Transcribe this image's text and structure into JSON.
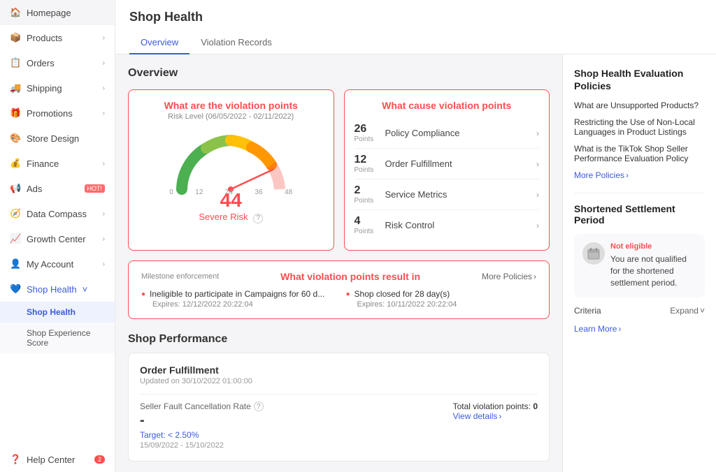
{
  "sidebar": {
    "items": [
      {
        "id": "homepage",
        "label": "Homepage",
        "icon": "🏠",
        "expandable": false
      },
      {
        "id": "products",
        "label": "Products",
        "icon": "📦",
        "expandable": true
      },
      {
        "id": "orders",
        "label": "Orders",
        "icon": "📋",
        "expandable": true
      },
      {
        "id": "shipping",
        "label": "Shipping",
        "icon": "🚚",
        "expandable": true
      },
      {
        "id": "promotions",
        "label": "Promotions",
        "icon": "🎁",
        "expandable": true
      },
      {
        "id": "store-design",
        "label": "Store Design",
        "icon": "🎨",
        "expandable": false
      },
      {
        "id": "finance",
        "label": "Finance",
        "icon": "💰",
        "expandable": true
      },
      {
        "id": "ads",
        "label": "Ads",
        "icon": "📢",
        "expandable": false,
        "badge": "HOT!"
      },
      {
        "id": "data-compass",
        "label": "Data Compass",
        "icon": "🧭",
        "expandable": true
      },
      {
        "id": "growth-center",
        "label": "Growth Center",
        "icon": "📈",
        "expandable": true
      },
      {
        "id": "my-account",
        "label": "My Account",
        "icon": "👤",
        "expandable": true
      },
      {
        "id": "shop-health",
        "label": "Shop Health",
        "icon": "💙",
        "expandable": true,
        "expanded": true
      },
      {
        "id": "help-center",
        "label": "Help Center",
        "icon": "❓",
        "expandable": false,
        "badge_count": "2"
      }
    ],
    "sub_items": {
      "shop-health": [
        {
          "id": "shop-health-main",
          "label": "Shop Health",
          "active": true
        },
        {
          "id": "shop-experience-score",
          "label": "Shop Experience Score"
        }
      ]
    }
  },
  "header": {
    "title": "Shop Health",
    "tabs": [
      {
        "id": "overview",
        "label": "Overview",
        "active": true
      },
      {
        "id": "violation-records",
        "label": "Violation Records",
        "active": false
      }
    ]
  },
  "overview": {
    "title": "Overview",
    "violation_card": {
      "title": "What are the violation points",
      "risk_level_label": "Risk Level (06/05/2022 - 02/11/2022)",
      "gauge_ticks": [
        "0",
        "12",
        "24",
        "36",
        "48"
      ],
      "score": "44",
      "severity": "Severe Risk",
      "severity_icon": "?"
    },
    "cause_card": {
      "title": "What cause violation points",
      "items": [
        {
          "points": "26",
          "label": "Points",
          "name": "Policy Compliance"
        },
        {
          "points": "12",
          "label": "Points",
          "name": "Order Fulfillment"
        },
        {
          "points": "2",
          "label": "Points",
          "name": "Service Metrics"
        },
        {
          "points": "4",
          "label": "Points",
          "name": "Risk Control"
        }
      ]
    },
    "milestone_card": {
      "label": "Milestone enforcement",
      "title": "What violation points result in",
      "more_policies": "More Policies",
      "items": [
        {
          "text": "Ineligible to participate in Campaigns for 60 d...",
          "expiry": "Expires: 12/12/2022 20:22:04"
        },
        {
          "text": "Shop closed for 28 day(s)",
          "expiry": "Expires: 10/11/2022 20:22:04"
        }
      ]
    }
  },
  "shop_performance": {
    "title": "Shop Performance",
    "order_fulfillment": {
      "title": "Order Fulfillment",
      "updated": "Updated on 30/10/2022 01:00:00",
      "total_violation_label": "Total violation points:",
      "total_violation_value": "0",
      "metric": {
        "name": "Seller Fault Cancellation Rate",
        "dash": "-",
        "target_label": "Target: < 2.50%",
        "date_range": "15/09/2022 - 15/10/2022"
      },
      "view_details": "View details"
    }
  },
  "right_panel": {
    "evaluation_title": "Shop Health Evaluation Policies",
    "links": [
      "What are Unsupported Products?",
      "Restricting the Use of Non-Local Languages in Product Listings",
      "What is the TikTok Shop Seller Performance Evaluation Policy"
    ],
    "more_policies": "More Policies",
    "settlement_title": "Shortened Settlement Period",
    "not_eligible": "Not eligible",
    "settlement_text": "You are not qualified for the shortened settlement period.",
    "criteria_label": "Criteria",
    "expand_label": "Expand",
    "learn_more": "Learn More"
  }
}
